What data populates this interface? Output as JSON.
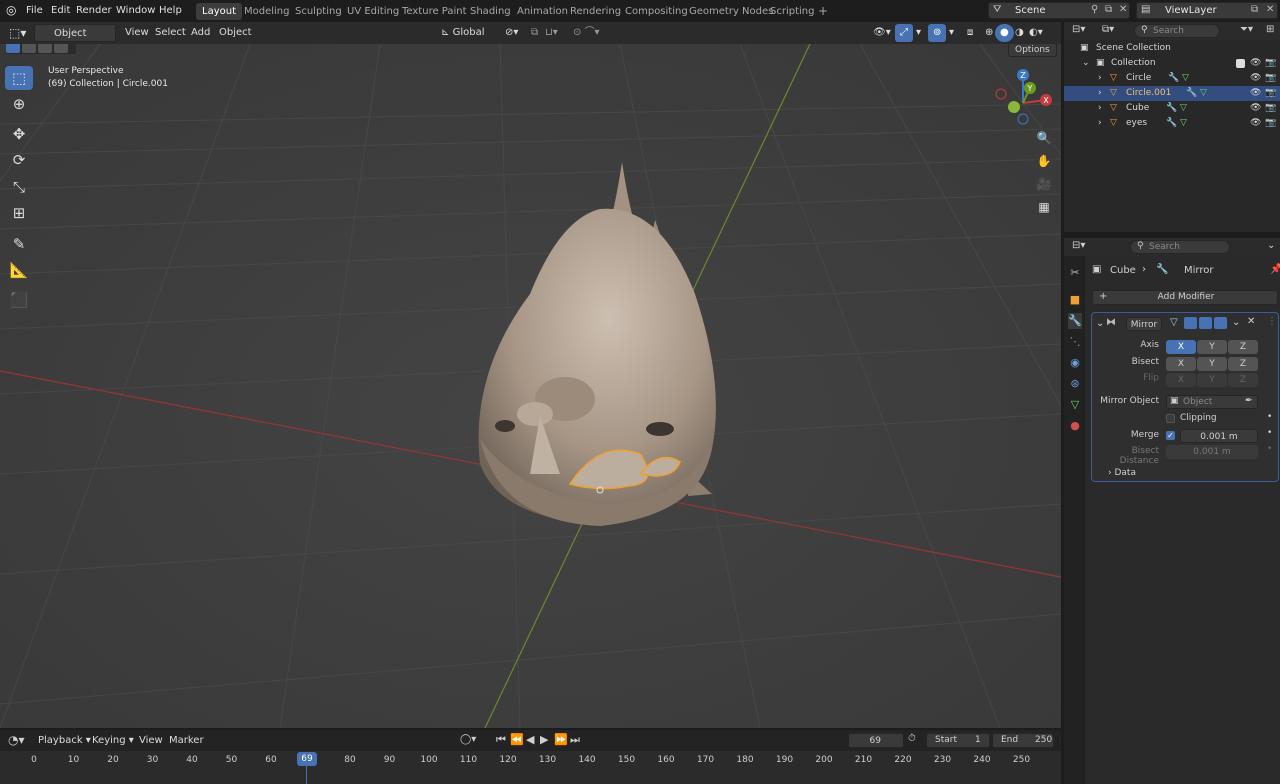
{
  "menubar": {
    "items": [
      "File",
      "Edit",
      "Render",
      "Window",
      "Help"
    ]
  },
  "workspaces": [
    "Layout",
    "Modeling",
    "Sculpting",
    "UV Editing",
    "Texture Paint",
    "Shading",
    "Animation",
    "Rendering",
    "Compositing",
    "Geometry Nodes",
    "Scripting",
    "+"
  ],
  "scene": {
    "name": "Scene",
    "view_layer": "ViewLayer"
  },
  "viewport_header": {
    "mode": "Object Mode",
    "menus": [
      "View",
      "Select",
      "Add",
      "Object"
    ],
    "transform": "Global",
    "options": "Options"
  },
  "overlay": {
    "title": "User Perspective",
    "subtitle": "(69) Collection | Circle.001"
  },
  "gizmo": {
    "x": "X",
    "y": "Y",
    "z": "Z"
  },
  "outliner": {
    "search_placeholder": "Search",
    "root": "Scene Collection",
    "collection": "Collection",
    "objects": [
      "Circle",
      "Circle.001",
      "Cube",
      "eyes"
    ],
    "selected": "Circle.001"
  },
  "properties": {
    "search_placeholder": "Search",
    "breadcrumb_object": "Cube",
    "breadcrumb_modifier": "Mirror",
    "add_modifier": "Add Modifier",
    "modifier_name": "Mirror",
    "axis_label": "Axis",
    "bisect_label": "Bisect",
    "flip_label": "Flip",
    "axes": [
      "X",
      "Y",
      "Z"
    ],
    "mirror_object_label": "Mirror Object",
    "mirror_object_placeholder": "Object",
    "clipping_label": "Clipping",
    "merge_label": "Merge",
    "merge_value": "0.001 m",
    "bisect_distance_label": "Bisect Distance",
    "bisect_distance_value": "0.001 m",
    "data_label": "Data"
  },
  "timeline": {
    "menus": [
      "Playback",
      "Keying",
      "View",
      "Marker"
    ],
    "current_frame": "69",
    "start_label": "Start",
    "start": "1",
    "end_label": "End",
    "end": "250",
    "ticks": [
      "0",
      "10",
      "20",
      "30",
      "40",
      "50",
      "60",
      "69",
      "80",
      "90",
      "100",
      "110",
      "120",
      "130",
      "140",
      "150",
      "160",
      "170",
      "180",
      "190",
      "200",
      "210",
      "220",
      "230",
      "240",
      "250"
    ]
  },
  "colors": {
    "accent": "#4772b3",
    "selection": "#334d80",
    "x_axis": "#c43c3c",
    "y_axis": "#6b9a23",
    "z_axis": "#3b7ac8",
    "highlight": "#f0a030"
  }
}
